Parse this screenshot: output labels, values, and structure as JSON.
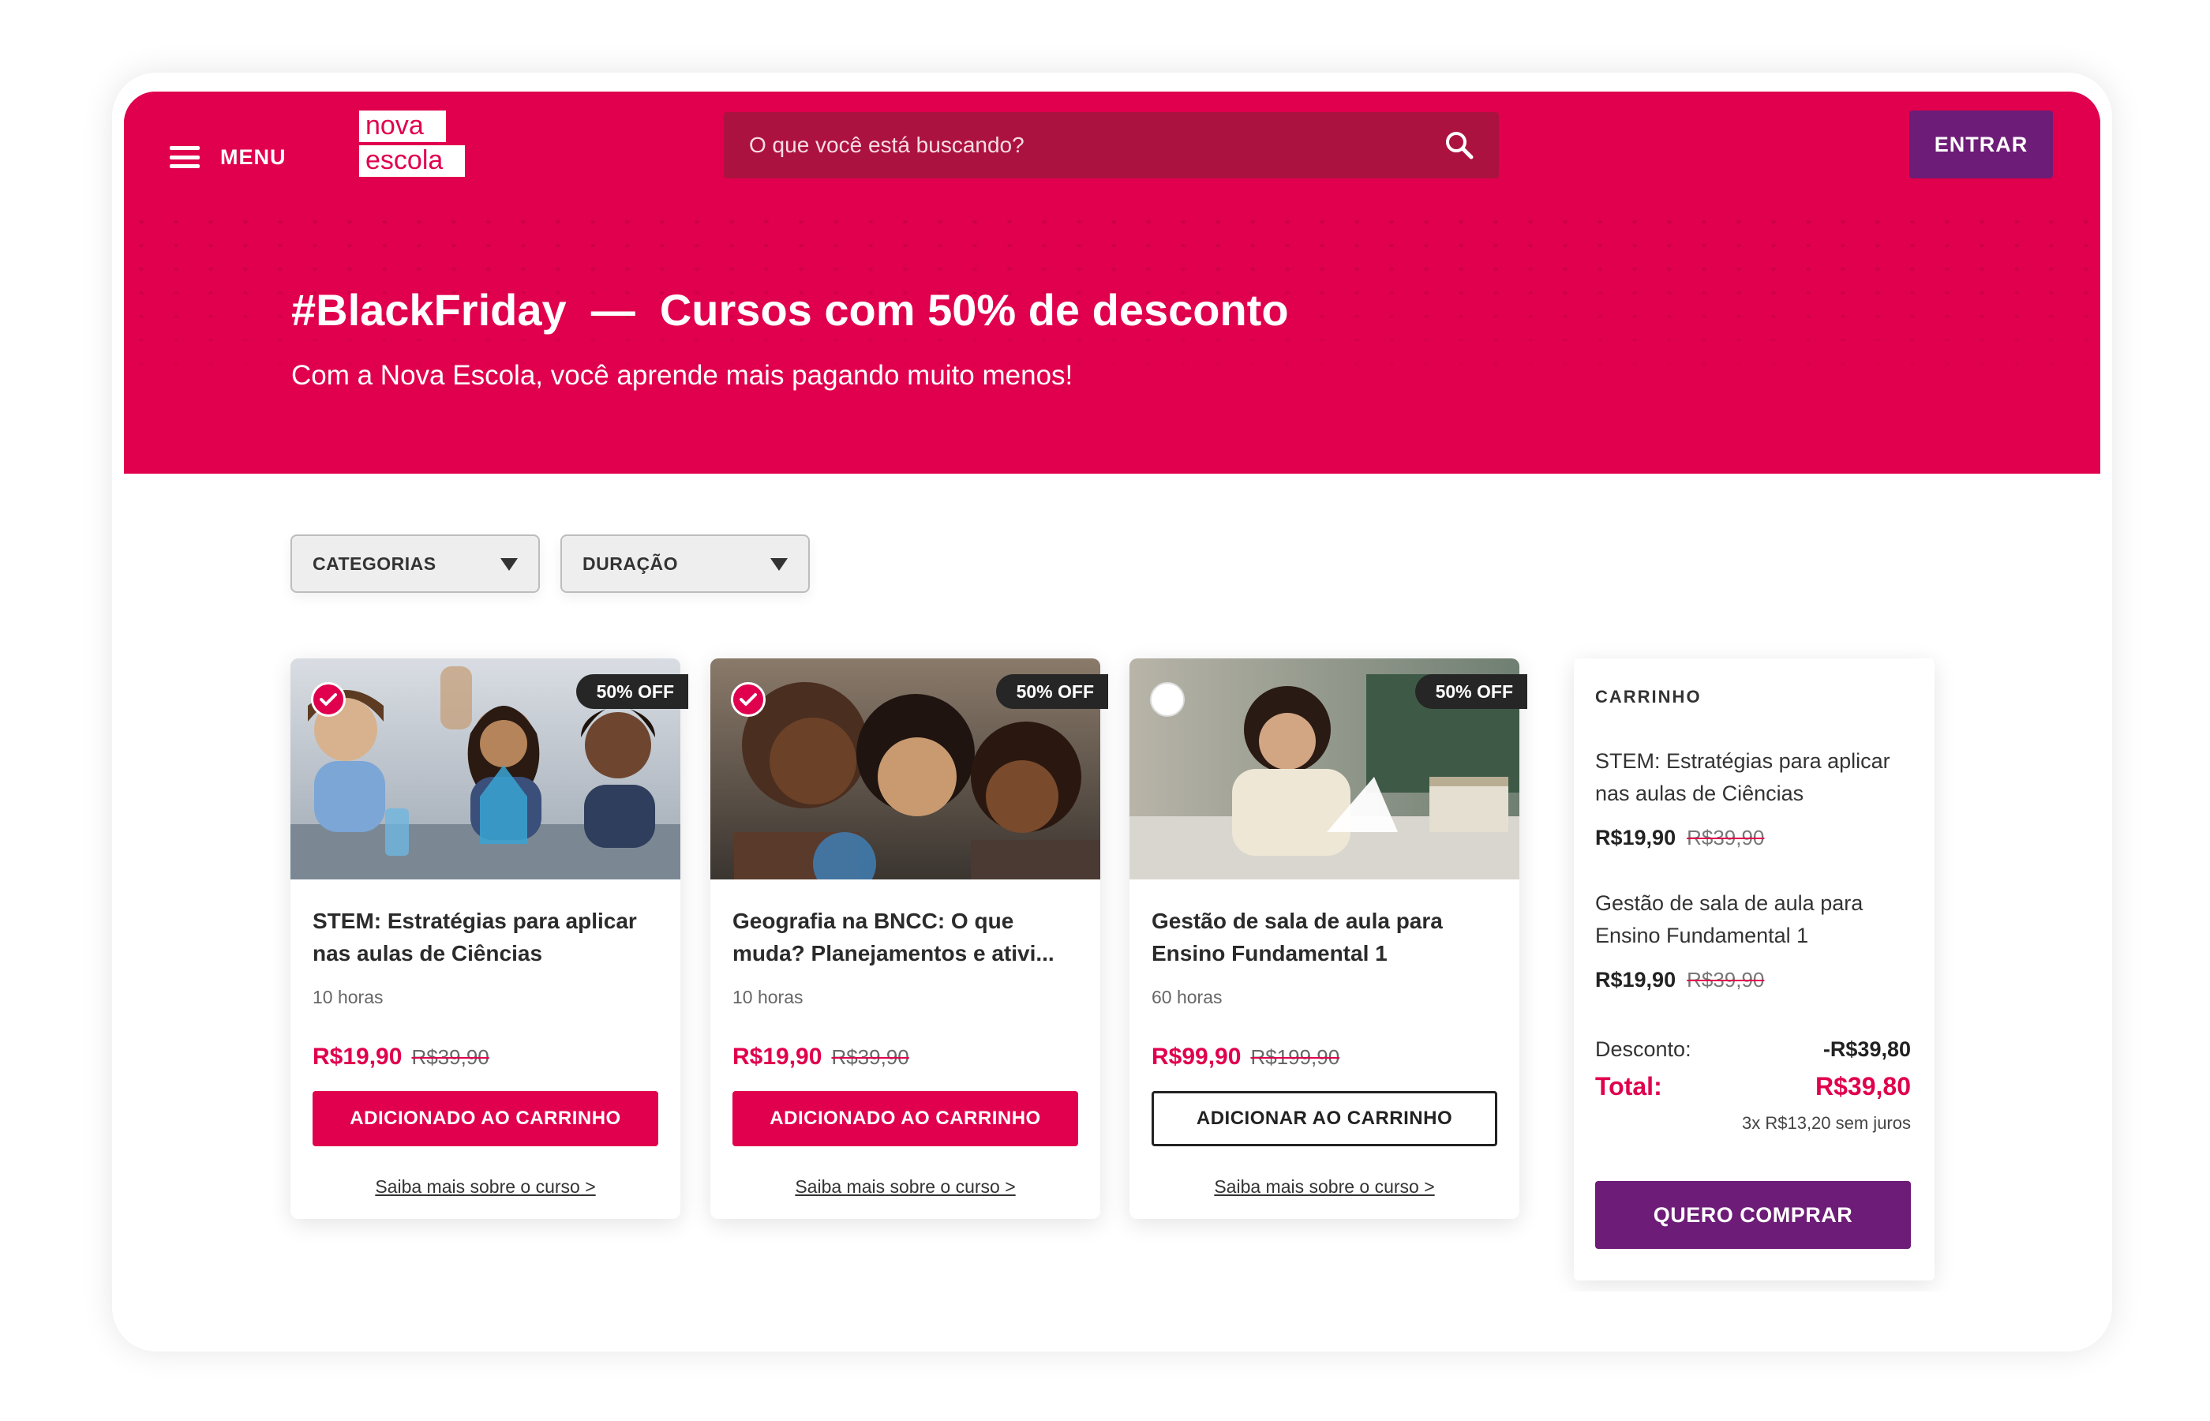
{
  "header": {
    "menu_label": "MENU",
    "logo_line1": "nova",
    "logo_line2": "escola",
    "search_placeholder": "O que você está buscando?",
    "login_label": "ENTRAR"
  },
  "hero": {
    "title": "#BlackFriday  —  Cursos com 50% de desconto",
    "subtitle": "Com a Nova Escola, você aprende mais pagando muito menos!"
  },
  "filters": [
    {
      "label": "CATEGORIAS"
    },
    {
      "label": "DURAÇÃO"
    }
  ],
  "courses": [
    {
      "badge": "50% OFF",
      "selected": true,
      "title": "STEM: Estratégias para aplicar nas aulas de Ciências",
      "hours": "10 horas",
      "price": "R$19,90",
      "old_price": "R$39,90",
      "button": "ADICIONADO AO CARRINHO",
      "link": "Saiba mais sobre o curso >"
    },
    {
      "badge": "50% OFF",
      "selected": true,
      "title": "Geografia na BNCC: O que muda? Planejamentos e ativi...",
      "hours": "10 horas",
      "price": "R$19,90",
      "old_price": "R$39,90",
      "button": "ADICIONADO AO CARRINHO",
      "link": "Saiba mais sobre o curso >"
    },
    {
      "badge": "50% OFF",
      "selected": false,
      "title": "Gestão de sala de aula para Ensino Fundamental 1",
      "hours": "60 horas",
      "price": "R$99,90",
      "old_price": "R$199,90",
      "button": "ADICIONAR AO CARRINHO",
      "link": "Saiba mais sobre o curso >"
    }
  ],
  "cart": {
    "heading": "CARRINHO",
    "items": [
      {
        "title": "STEM: Estratégias para aplicar nas aulas de Ciências",
        "price": "R$19,90",
        "old_price": "R$39,90"
      },
      {
        "title": "Gestão de sala de aula para Ensino Fundamental 1",
        "price": "R$19,90",
        "old_price": "R$39,90"
      }
    ],
    "discount_label": "Desconto:",
    "discount_value": "-R$39,80",
    "total_label": "Total:",
    "total_value": "R$39,80",
    "installments": "3x R$13,20 sem juros",
    "buy_label": "QUERO COMPRAR"
  },
  "colors": {
    "brand": "#e0004d",
    "purple": "#6d1c77",
    "dark": "#262626"
  },
  "icons": [
    "menu-icon",
    "search-icon",
    "dropdown-caret-icon",
    "check-icon"
  ]
}
